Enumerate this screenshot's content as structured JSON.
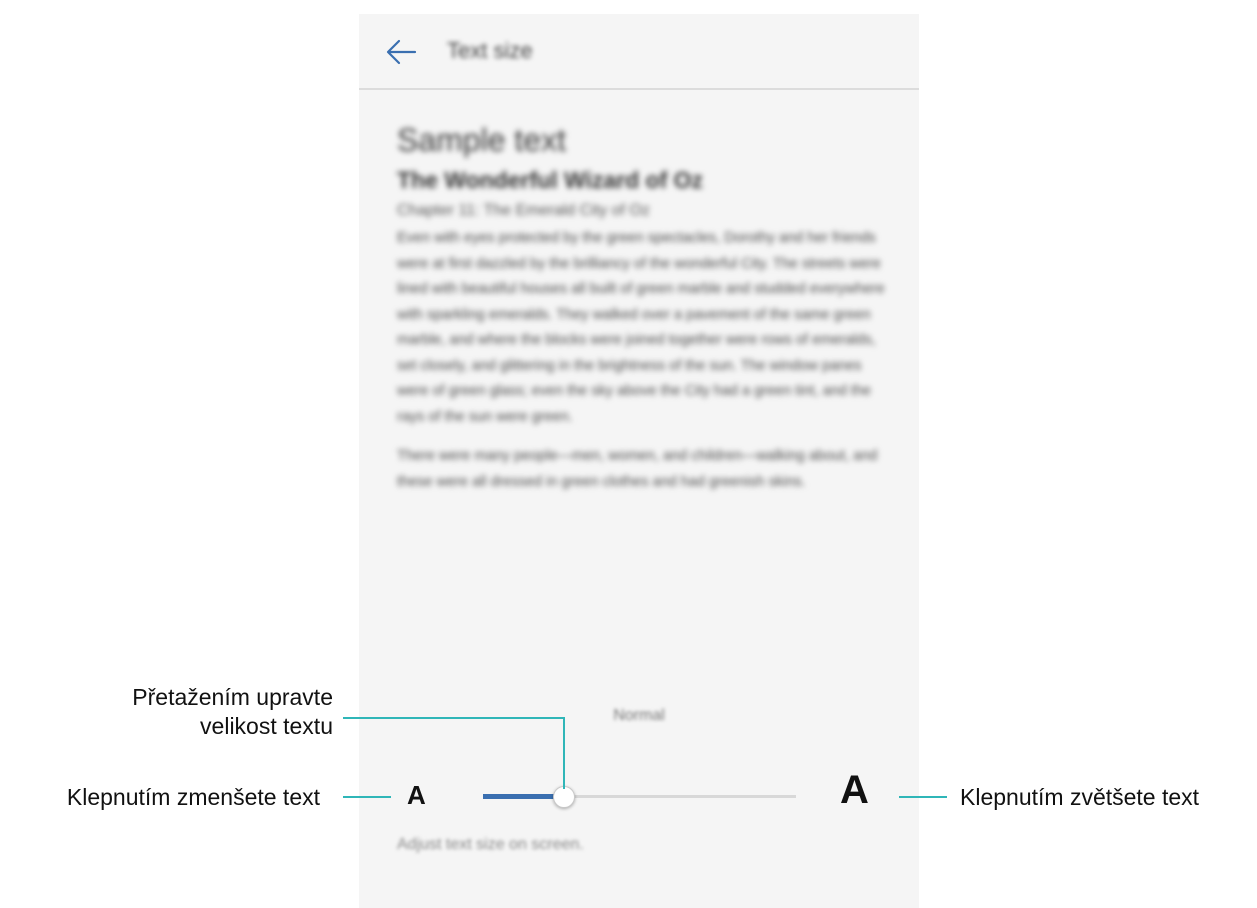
{
  "appbar": {
    "title": "Text size"
  },
  "sample": {
    "heading": "Sample text",
    "title": "The Wonderful Wizard of Oz",
    "chapter": "Chapter 11: The Emerald City of Oz",
    "paragraphs": [
      "Even with eyes protected by the green spectacles, Dorothy and her friends were at first dazzled by the brilliancy of the wonderful City. The streets were lined with beautiful houses all built of green marble and studded everywhere with sparkling emeralds. They walked over a pavement of the same green marble, and where the blocks were joined together were rows of emeralds, set closely, and glittering in the brightness of the sun. The window panes were of green glass; even the sky above the City had a green tint, and the rays of the sun were green.",
      "There were many people—men, women, and children—walking about, and these were all dressed in green clothes and had greenish skins."
    ]
  },
  "slider": {
    "current_label": "Normal",
    "small_label": "A",
    "large_label": "A",
    "value_fraction": 0.26
  },
  "hint": "Adjust text size on screen.",
  "callouts": {
    "drag_line1": "Přetažením upravte",
    "drag_line2": "velikost textu",
    "decrease": "Klepnutím zmenšete text",
    "increase": "Klepnutím zvětšete text"
  },
  "colors": {
    "accent": "#3a6fb0",
    "callout_line": "#2fb6b8"
  }
}
